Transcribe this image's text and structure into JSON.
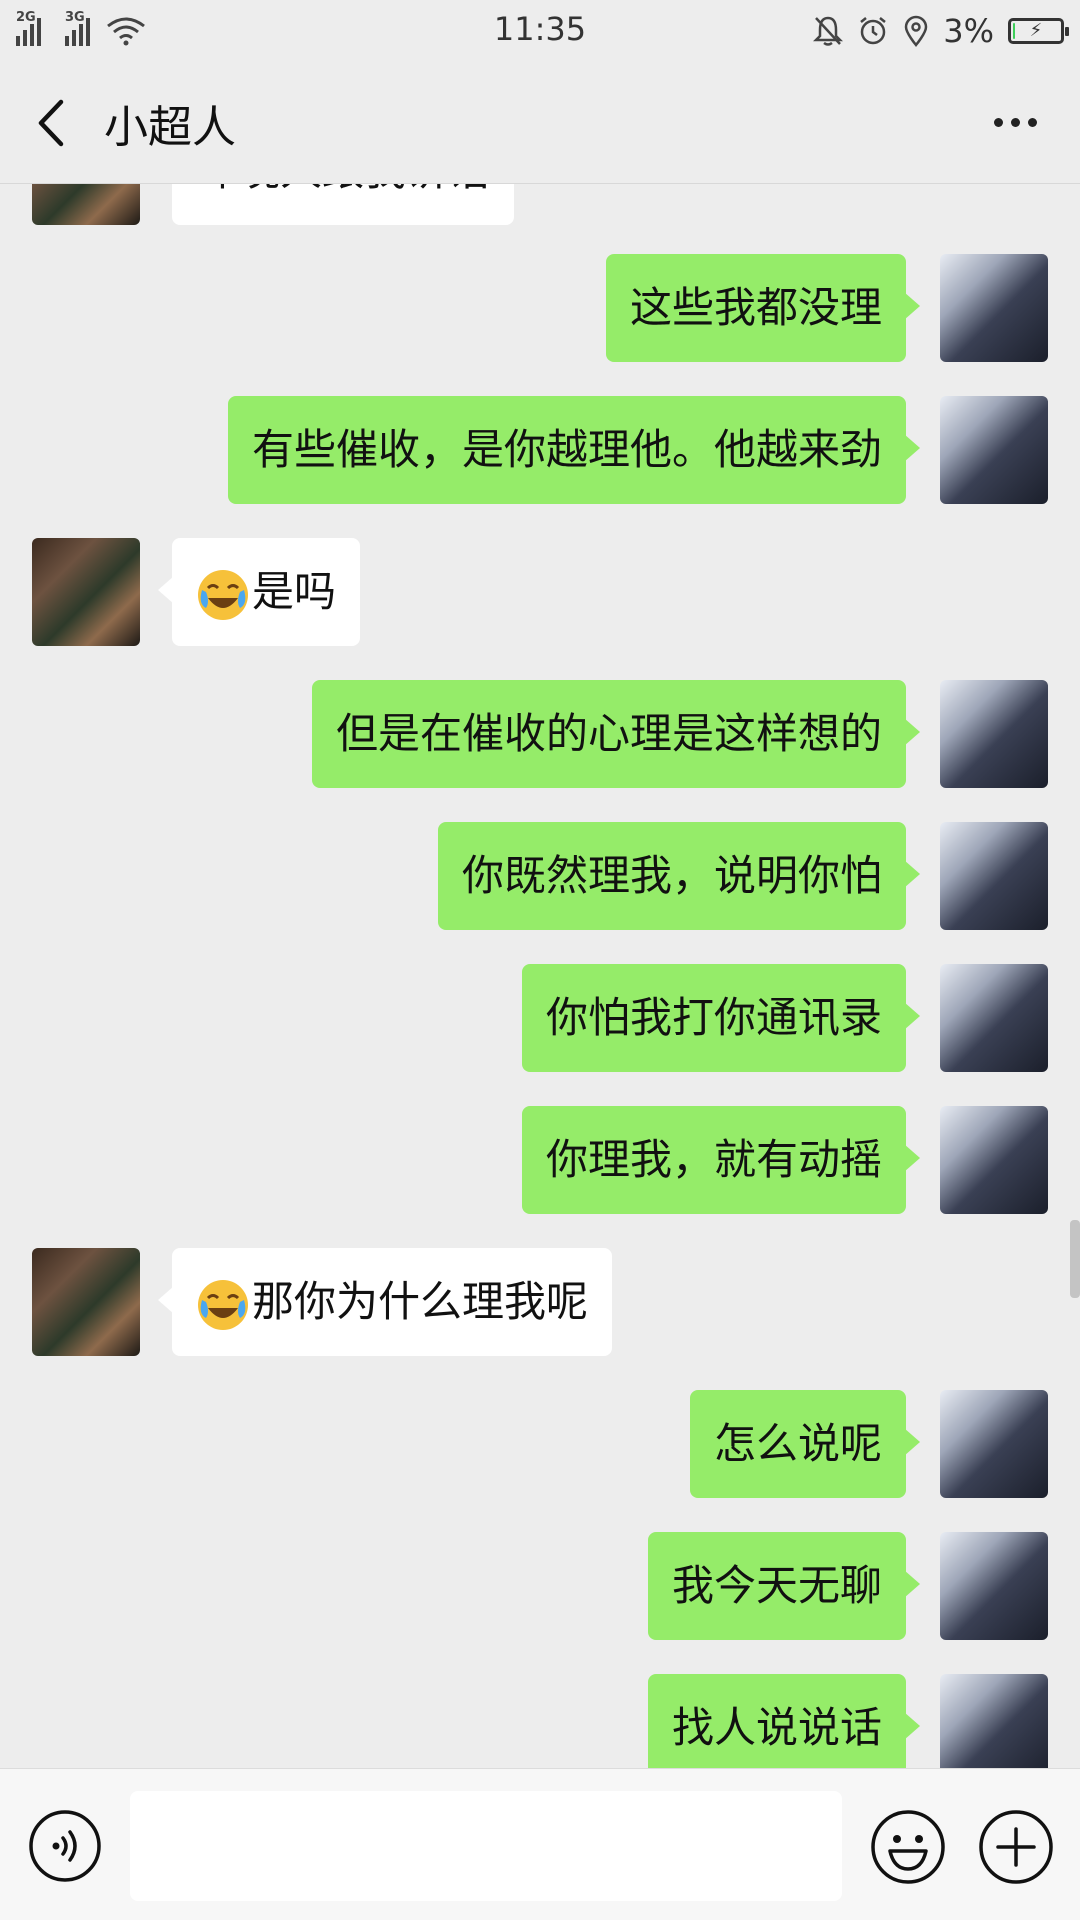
{
  "status_bar": {
    "signal_1_label": "2G",
    "signal_2_label": "3G",
    "time": "11:35",
    "battery_percent": "3%",
    "battery_level": 0.03,
    "icons": [
      "signal-2g-icon",
      "signal-3g-icon",
      "wifi-icon",
      "muted-bell-icon",
      "alarm-icon",
      "location-icon",
      "battery-charging-icon"
    ]
  },
  "header": {
    "title": "小超人",
    "back_icon": "chevron-left-icon",
    "more_icon": "more-dots-icon"
  },
  "colors": {
    "outgoing_bubble": "#95ec69",
    "incoming_bubble": "#ffffff",
    "background": "#ededed"
  },
  "messages": [
    {
      "side": "in",
      "text": "昨晚人跟我讲话"
    },
    {
      "side": "out",
      "text": "这些我都没理"
    },
    {
      "side": "out",
      "text": "有些催收，是你越理他。他越来劲"
    },
    {
      "side": "in",
      "emoji": "laughing-crying-emoji",
      "text": "是吗"
    },
    {
      "side": "out",
      "text": "但是在催收的心理是这样想的"
    },
    {
      "side": "out",
      "text": "你既然理我，说明你怕"
    },
    {
      "side": "out",
      "text": "你怕我打你通讯录"
    },
    {
      "side": "out",
      "text": "你理我，就有动摇"
    },
    {
      "side": "in",
      "emoji": "laughing-crying-emoji",
      "text": "那你为什么理我呢"
    },
    {
      "side": "out",
      "text": "怎么说呢"
    },
    {
      "side": "out",
      "text": "我今天无聊"
    },
    {
      "side": "out",
      "text": "找人说说话"
    }
  ],
  "input_bar": {
    "value": "",
    "voice_icon": "voice-icon",
    "emoji_icon": "emoji-icon",
    "plus_icon": "plus-icon"
  }
}
